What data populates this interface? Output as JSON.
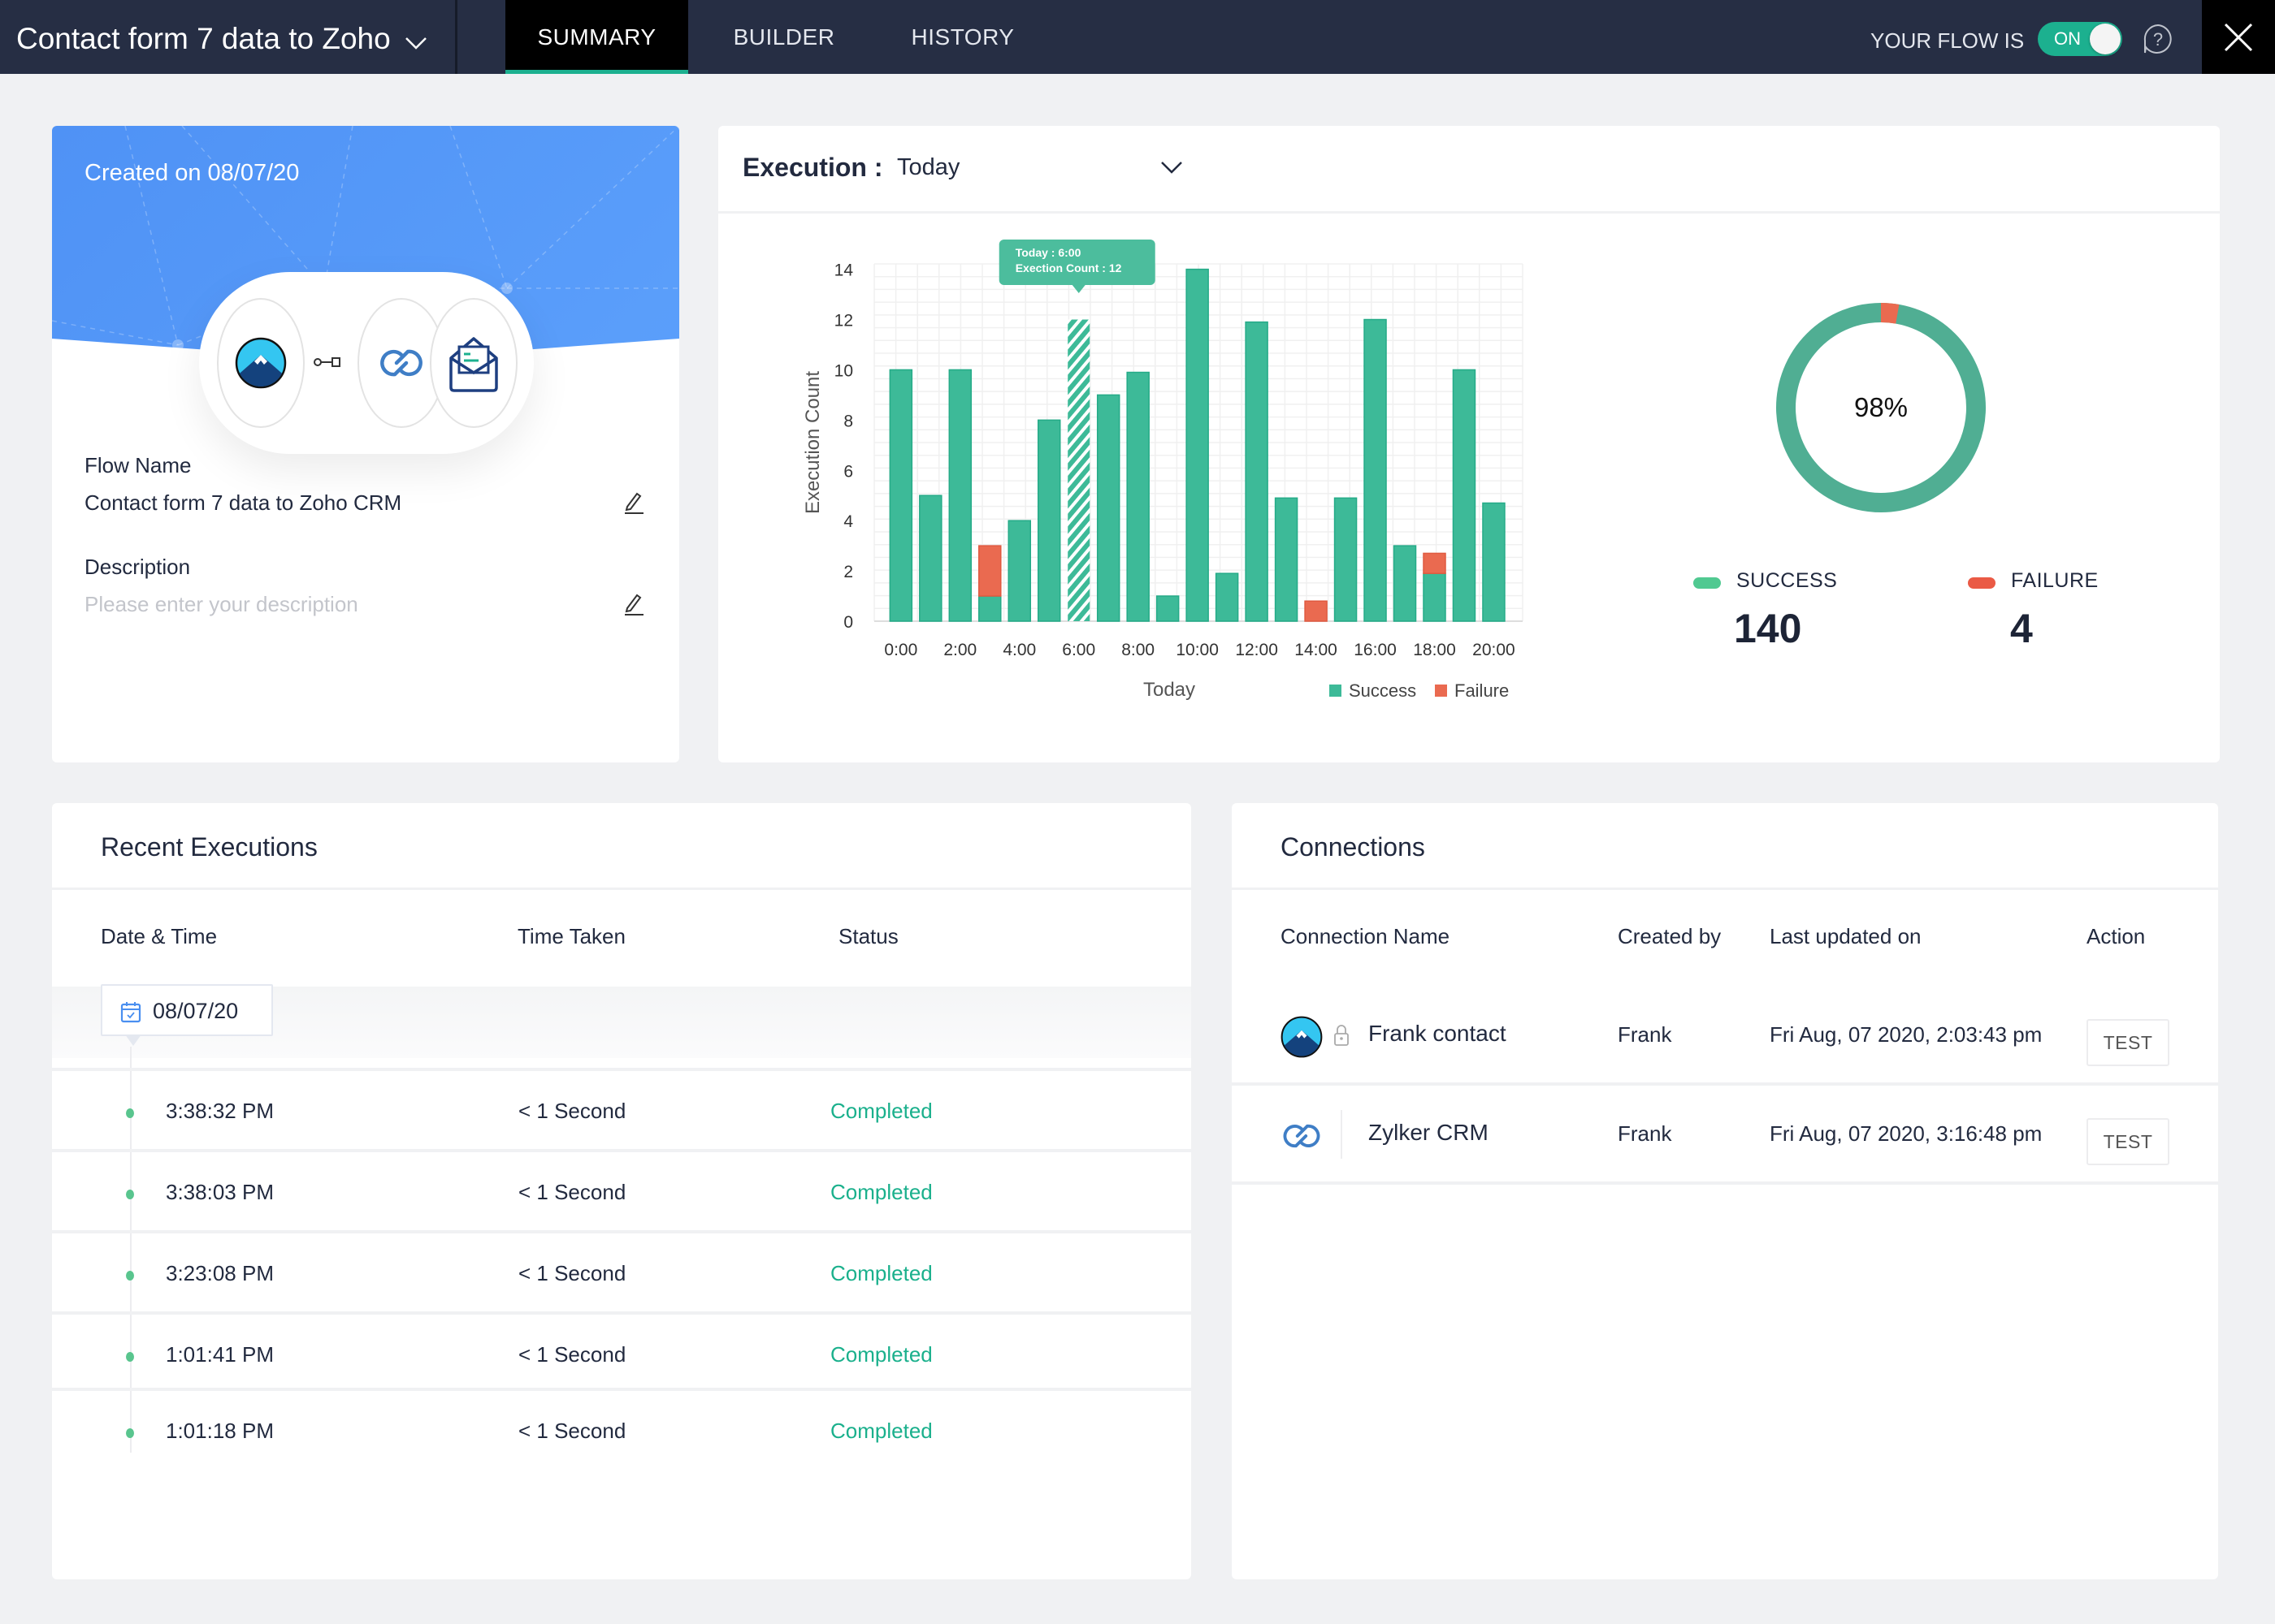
{
  "header": {
    "flow_title": "Contact form 7 data to Zoho",
    "tabs": [
      {
        "label": "SUMMARY",
        "active": true
      },
      {
        "label": "BUILDER",
        "active": false
      },
      {
        "label": "HISTORY",
        "active": false
      }
    ],
    "flow_status_label": "YOUR FLOW IS",
    "toggle_label": "ON",
    "toggle_on": true,
    "help_symbol": "?",
    "icons": [
      "chevron-down-icon",
      "help-icon",
      "close-icon"
    ]
  },
  "flow_card": {
    "created_on": "Created on 08/07/20",
    "apps": [
      "contact-form-7-icon",
      "zoho-crm-icon",
      "email-parser-icon"
    ],
    "flow_name_label": "Flow Name",
    "flow_name_value": "Contact form 7 data to Zoho CRM",
    "description_label": "Description",
    "description_placeholder": "Please enter your description"
  },
  "execution": {
    "label": "Execution :",
    "period": "Today",
    "tooltip_line1": "Today : 6:00",
    "tooltip_line2": "Exection Count : 12",
    "donut_percent": "98%",
    "success_label": "SUCCESS",
    "failure_label": "FAILURE",
    "success_count": "140",
    "failure_count": "4"
  },
  "chart_data": [
    {
      "type": "bar",
      "stacked": true,
      "title": "",
      "xlabel": "Today",
      "ylabel": "Execution Count",
      "ylim": [
        0,
        14
      ],
      "yticks": [
        0,
        2,
        4,
        6,
        8,
        10,
        12,
        14
      ],
      "x": [
        "0:00",
        "1:00",
        "2:00",
        "3:00",
        "4:00",
        "5:00",
        "6:00",
        "7:00",
        "8:00",
        "9:00",
        "10:00",
        "11:00",
        "12:00",
        "13:00",
        "14:00",
        "15:00",
        "16:00",
        "17:00",
        "18:00",
        "19:00",
        "20:00"
      ],
      "xtick_labels": [
        "0:00",
        "2:00",
        "4:00",
        "6:00",
        "8:00",
        "10:00",
        "12:00",
        "14:00",
        "16:00",
        "18:00",
        "20:00"
      ],
      "series": [
        {
          "name": "Success",
          "color": "#3dba98",
          "values": [
            10,
            5,
            10,
            1,
            4,
            8,
            12,
            9,
            9.9,
            1,
            14,
            1.9,
            11.9,
            4.9,
            0,
            4.9,
            12,
            3,
            1.9,
            10,
            4.7
          ]
        },
        {
          "name": "Failure",
          "color": "#ea6a50",
          "values": [
            0,
            0,
            0,
            2,
            0,
            0,
            0,
            0,
            0,
            0,
            0,
            0,
            0,
            0,
            0.8,
            0,
            0,
            0,
            0.8,
            0,
            0
          ]
        }
      ],
      "highlighted": "6:00",
      "grid": true,
      "legend": "bottom-right"
    },
    {
      "type": "pie",
      "donut": true,
      "labels": [
        "Success",
        "Failure"
      ],
      "values": [
        140,
        4
      ],
      "colors": [
        "#50ae93",
        "#ea6a50"
      ],
      "center_label": "98%"
    }
  ],
  "recent": {
    "title": "Recent Executions",
    "columns": [
      "Date & Time",
      "Time Taken",
      "Status"
    ],
    "date": "08/07/20",
    "rows": [
      {
        "time": "3:38:32 PM",
        "taken": "< 1 Second",
        "status": "Completed"
      },
      {
        "time": "3:38:03 PM",
        "taken": "< 1 Second",
        "status": "Completed"
      },
      {
        "time": "3:23:08 PM",
        "taken": "< 1 Second",
        "status": "Completed"
      },
      {
        "time": "1:01:41 PM",
        "taken": "< 1 Second",
        "status": "Completed"
      },
      {
        "time": "1:01:18 PM",
        "taken": "< 1 Second",
        "status": "Completed"
      }
    ]
  },
  "connections": {
    "title": "Connections",
    "columns": [
      "Connection Name",
      "Created by",
      "Last updated on",
      "Action"
    ],
    "rows": [
      {
        "icon": "contact-form-7-icon",
        "locked": true,
        "name": "Frank contact",
        "created_by": "Frank",
        "updated": "Fri Aug, 07 2020, 2:03:43 pm",
        "action": "TEST"
      },
      {
        "icon": "zoho-crm-icon",
        "locked": false,
        "name": "Zylker CRM",
        "created_by": "Frank",
        "updated": "Fri Aug, 07 2020, 3:16:48 pm",
        "action": "TEST"
      }
    ]
  },
  "colors": {
    "header_bg": "#262e44",
    "accent": "#1cb08f",
    "success": "#3dba98",
    "failure": "#ea6a50",
    "banner": "#5598f8"
  }
}
